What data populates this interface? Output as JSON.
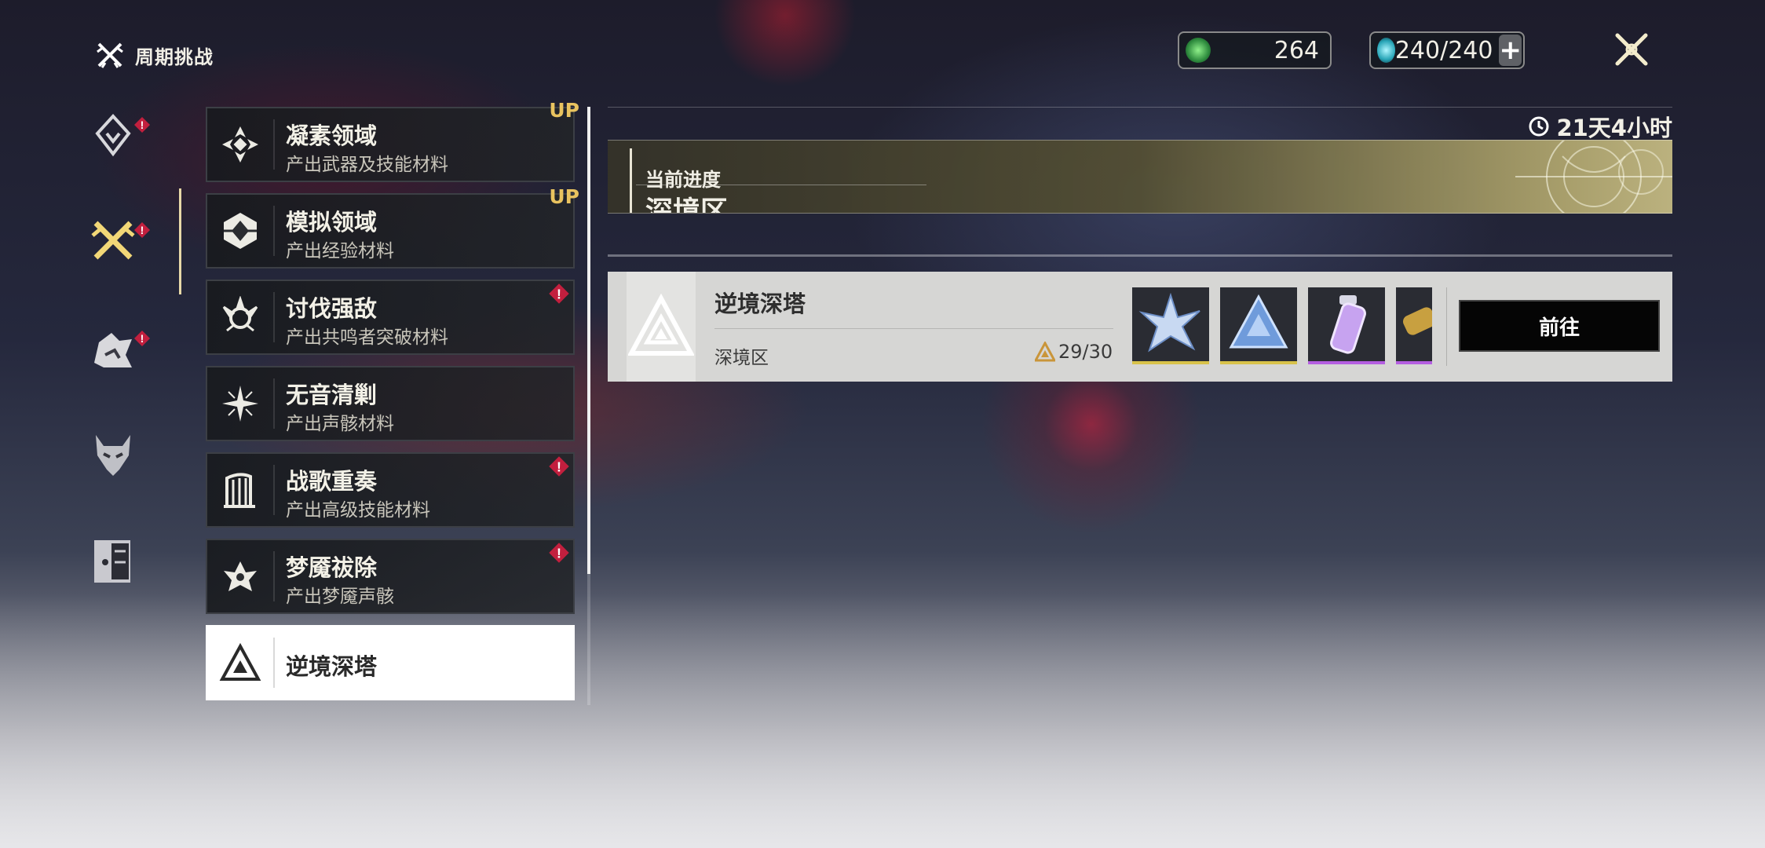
{
  "header": {
    "title": "周期挑战"
  },
  "currencies": [
    {
      "icon": "waveplate-crystal-icon",
      "value": "264"
    },
    {
      "icon": "waveplate-icon",
      "value": "240/240"
    }
  ],
  "rail": {
    "items": [
      {
        "icon": "resonance-icon",
        "alert": true
      },
      {
        "icon": "crossed-swords-icon",
        "alert": true,
        "selected": true
      },
      {
        "icon": "beast-icon",
        "alert": true
      },
      {
        "icon": "demon-mask-icon",
        "alert": false
      },
      {
        "icon": "door-icon",
        "alert": false
      }
    ]
  },
  "categories": [
    {
      "name": "凝素领域",
      "sub": "产出武器及技能材料",
      "up": "UP",
      "alert": false
    },
    {
      "name": "模拟领域",
      "sub": "产出经验材料",
      "up": "UP",
      "alert": false
    },
    {
      "name": "讨伐强敌",
      "sub": "产出共鸣者突破材料",
      "up": "",
      "alert": true
    },
    {
      "name": "无音清剿",
      "sub": "产出声骸材料",
      "up": "",
      "alert": false
    },
    {
      "name": "战歌重奏",
      "sub": "产出高级技能材料",
      "up": "",
      "alert": true
    },
    {
      "name": "梦魇祓除",
      "sub": "产出梦魇声骸",
      "up": "",
      "alert": true
    },
    {
      "name": "逆境深塔",
      "sub": "",
      "up": "",
      "alert": false,
      "selected": true
    }
  ],
  "panel": {
    "timer": "21天4小时",
    "progress_label": "当前进度",
    "progress_stage": "深境区",
    "card": {
      "name": "逆境深塔",
      "stage": "深境区",
      "progress": "29/30",
      "rewards": [
        {
          "icon": "star-crystal-icon",
          "rarity": "gold",
          "color": "#d8c24a"
        },
        {
          "icon": "blue-prism-icon",
          "rarity": "gold",
          "color": "#d8c24a"
        },
        {
          "icon": "vial-icon",
          "rarity": "purple",
          "color": "#b45ee0"
        },
        {
          "icon": "tube-icon",
          "rarity": "purple",
          "color": "#b45ee0"
        }
      ],
      "go_label": "前往"
    }
  }
}
